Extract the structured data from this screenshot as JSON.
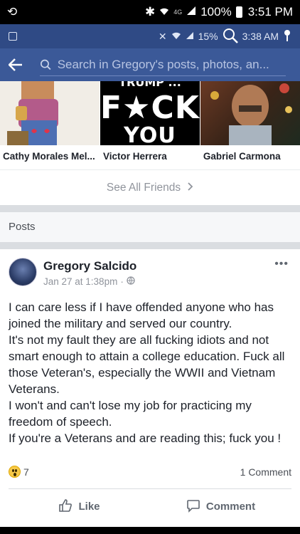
{
  "outer_status": {
    "battery": "100%",
    "time": "3:51 PM",
    "network": "4G"
  },
  "inner_status": {
    "battery": "15%",
    "time": "3:38 AM"
  },
  "header": {
    "search_placeholder": "Search in Gregory's posts, photos, an..."
  },
  "friends": [
    {
      "name": "Cathy Morales Mel..."
    },
    {
      "name": "Victor Herrera",
      "photo_text_top": "TRUMP ...",
      "photo_text_1": "F★CK",
      "photo_text_2": "YOU TOO"
    },
    {
      "name": "Gabriel Carmona"
    }
  ],
  "see_all_label": "See All Friends",
  "posts_header": "Posts",
  "post": {
    "author": "Gregory Salcido",
    "timestamp": "Jan 27 at 1:38pm",
    "lines": [
      "I can care less if I have offended anyone who has joined the military and served our country.",
      "It's not my fault they are all fucking idiots and not smart enough to attain a college education. Fuck all those Veteran's, especially the WWII and Vietnam Veterans.",
      "I won't and can't lose my job for practicing my freedom of speech.",
      "If you're a Veterans and are reading this; fuck you !"
    ],
    "reaction_count": "7",
    "comment_count": "1 Comment",
    "like_label": "Like",
    "comment_label": "Comment"
  },
  "colors": {
    "fb_blue": "#3b5998",
    "text": "#1d2129",
    "muted": "#90949c"
  }
}
